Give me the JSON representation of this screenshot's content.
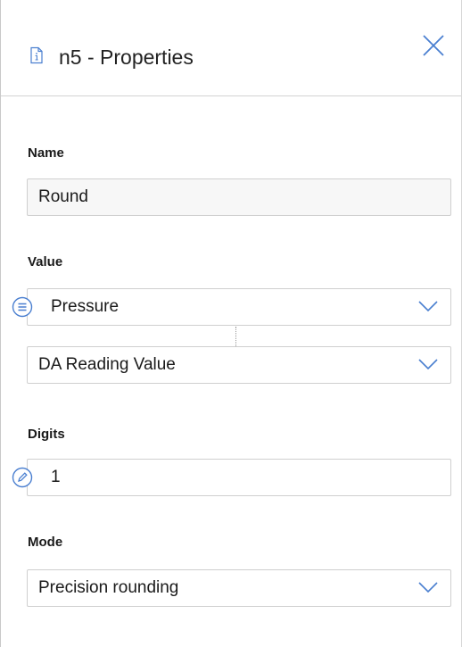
{
  "header": {
    "title": "n5 - Properties",
    "icon": "document-info-icon",
    "close_icon": "close-icon"
  },
  "fields": {
    "name": {
      "label": "Name",
      "value": "Round"
    },
    "value": {
      "label": "Value",
      "source": "Pressure",
      "source_icon": "list-icon",
      "field": "DA Reading Value"
    },
    "digits": {
      "label": "Digits",
      "value": "1",
      "value_icon": "pencil-icon"
    },
    "mode": {
      "label": "Mode",
      "value": "Precision rounding"
    }
  },
  "colors": {
    "accent": "#4a7fd0",
    "border": "#cfcfcf",
    "divider": "#d2d2d2"
  }
}
